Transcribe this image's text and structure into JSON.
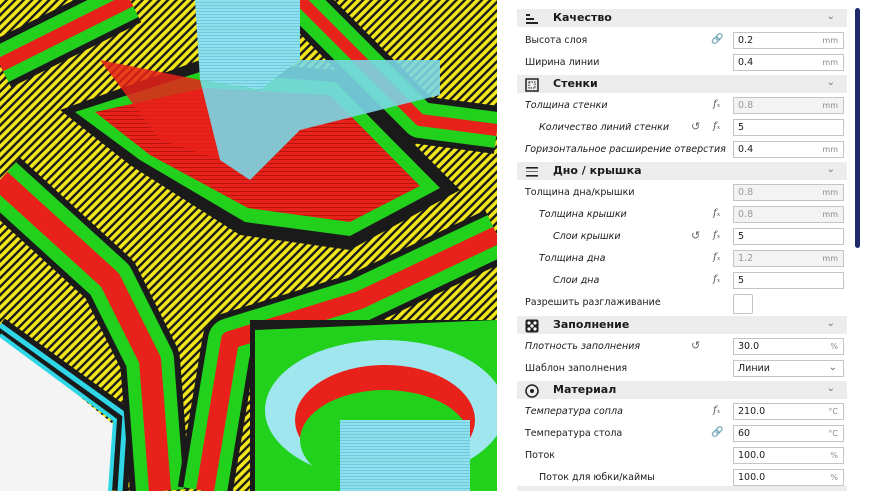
{
  "colors": {
    "wall_outer": "#e8211a",
    "wall_inner": "#22d11c",
    "skin": "#f3e61a",
    "support": "#7ad7e6",
    "accent": "#1f2a6b"
  },
  "viewport": {
    "name": "3D layer view"
  },
  "settings": {
    "quality": {
      "title": "Качество",
      "icon": "quality-icon",
      "layer_height": {
        "label": "Высота слоя",
        "value": "0.2",
        "unit": "mm"
      },
      "line_width": {
        "label": "Ширина линии",
        "value": "0.4",
        "unit": "mm"
      }
    },
    "walls": {
      "title": "Стенки",
      "icon": "walls-icon",
      "wall_thickness": {
        "label": "Толщина стенки",
        "value": "0.8",
        "unit": "mm"
      },
      "wall_line_count": {
        "label": "Количество линий стенки",
        "value": "5"
      },
      "hole_expansion": {
        "label": "Горизонтальное расширение отверстия",
        "value": "0.4",
        "unit": "mm"
      }
    },
    "top_bottom": {
      "title": "Дно / крышка",
      "icon": "top-bottom-icon",
      "thickness": {
        "label": "Толщина дна/крышки",
        "value": "0.8",
        "unit": "mm"
      },
      "top_thickness": {
        "label": "Толщина крышки",
        "value": "0.8",
        "unit": "mm"
      },
      "top_layers": {
        "label": "Слои крышки",
        "value": "5"
      },
      "bottom_thickness": {
        "label": "Толщина дна",
        "value": "1.2",
        "unit": "mm"
      },
      "bottom_layers": {
        "label": "Слои дна",
        "value": "5"
      },
      "ironing": {
        "label": "Разрешить разглаживание"
      }
    },
    "infill": {
      "title": "Заполнение",
      "icon": "infill-icon",
      "density": {
        "label": "Плотность заполнения",
        "value": "30.0",
        "unit": "%"
      },
      "pattern": {
        "label": "Шаблон заполнения",
        "value": "Линии"
      }
    },
    "material": {
      "title": "Материал",
      "icon": "material-icon",
      "nozzle_temp": {
        "label": "Температура сопла",
        "value": "210.0",
        "unit": "°C"
      },
      "bed_temp": {
        "label": "Температура стола",
        "value": "60",
        "unit": "°C"
      },
      "flow": {
        "label": "Поток",
        "value": "100.0",
        "unit": "%"
      },
      "skirt_flow": {
        "label": "Поток для юбки/каймы",
        "value": "100.0",
        "unit": "%"
      }
    }
  }
}
